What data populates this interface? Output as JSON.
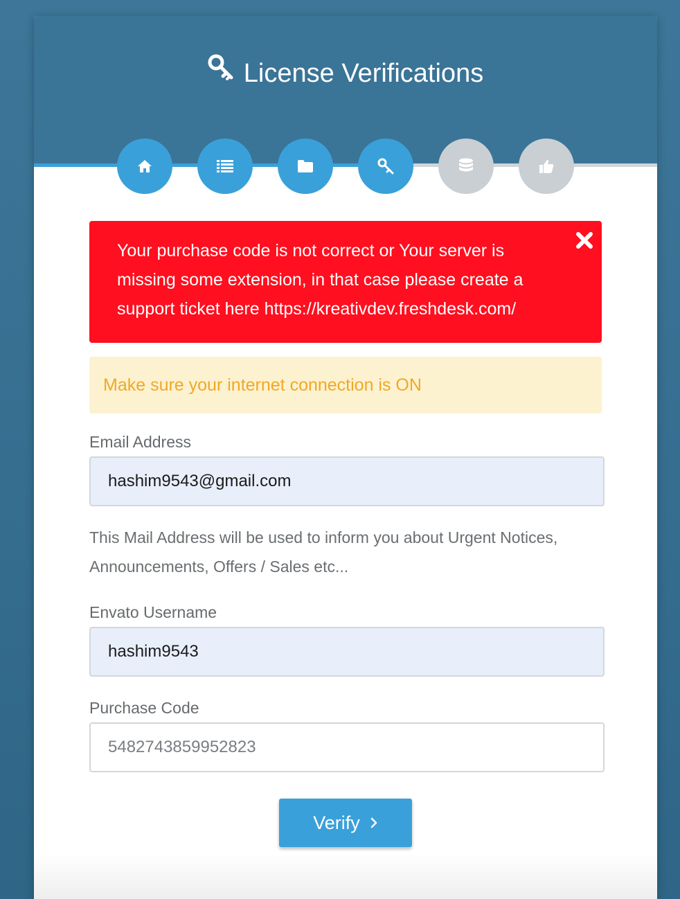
{
  "header": {
    "title": "License Verifications",
    "title_icon": "key-icon"
  },
  "steps": [
    {
      "icon": "home-icon",
      "state": "done"
    },
    {
      "icon": "list-icon",
      "state": "done"
    },
    {
      "icon": "folder-icon",
      "state": "done"
    },
    {
      "icon": "key-icon",
      "state": "current"
    },
    {
      "icon": "database-icon",
      "state": "pending"
    },
    {
      "icon": "thumbs-up-icon",
      "state": "pending"
    }
  ],
  "error_alert": {
    "message": "Your purchase code is not correct or Your server is missing some extension, in that case please create a support ticket here https://kreativdev.freshdesk.com/",
    "close_icon": "close-icon"
  },
  "warning_alert": {
    "message": "Make sure your internet connection is ON"
  },
  "form": {
    "email": {
      "label": "Email Address",
      "value": "hashim9543@gmail.com",
      "help": "This Mail Address will be used to inform you about Urgent Notices, Announcements, Offers / Sales etc..."
    },
    "username": {
      "label": "Envato Username",
      "value": "hashim9543"
    },
    "purchase_code": {
      "label": "Purchase Code",
      "placeholder": "5482743859952823"
    },
    "submit_label": "Verify"
  },
  "colors": {
    "background": "#3d7699",
    "header": "#3a7497",
    "accent": "#3aa0d9",
    "error": "#ff0f1f",
    "warning_bg": "#fdf2cf",
    "warning_text": "#f0a828",
    "inactive_step": "#c9cfd3"
  }
}
